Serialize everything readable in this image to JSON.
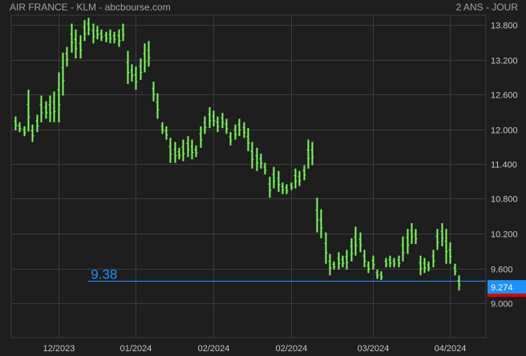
{
  "header": {
    "title": "AIR FRANCE - KLM - abcbourse.com",
    "period": "2 ANS - JOUR"
  },
  "colors": {
    "background": "#1e1e1e",
    "grid": "#3c3c3c",
    "bars": "#7cfc5c",
    "reference_line": "#1e90ff",
    "last_price_badge": "#1e90ff",
    "badge_underline": "#e00000",
    "text": "#a8a8a8"
  },
  "chart_data": {
    "type": "ohlc",
    "title": "AIR FRANCE - KLM - abcbourse.com",
    "ylim": [
      8.9,
      13.95
    ],
    "y_ticks": [
      "13.800",
      "13.200",
      "12.600",
      "12.000",
      "11.400",
      "10.800",
      "10.200",
      "9.600",
      "9.000"
    ],
    "y_tick_values": [
      13.8,
      13.2,
      12.6,
      12.0,
      11.4,
      10.8,
      10.2,
      9.6,
      9.0
    ],
    "x_ticks": [
      "12/2023",
      "01/2024",
      "02/2024",
      "02/2024",
      "03/2024",
      "04/2024"
    ],
    "x_tick_positions": [
      10,
      28,
      46,
      64,
      83,
      101
    ],
    "reference_line": {
      "value": 9.38,
      "label": "9.38",
      "start_index": 17
    },
    "last_price": {
      "value": 9.274,
      "label": "9.274"
    },
    "grid": true,
    "bars": [
      {
        "h": 12.22,
        "l": 11.98
      },
      {
        "h": 12.12,
        "l": 11.95
      },
      {
        "h": 12.05,
        "l": 11.88
      },
      {
        "h": 12.68,
        "l": 11.96
      },
      {
        "h": 12.08,
        "l": 11.78
      },
      {
        "h": 12.25,
        "l": 11.95
      },
      {
        "h": 12.58,
        "l": 12.12
      },
      {
        "h": 12.48,
        "l": 12.18
      },
      {
        "h": 12.58,
        "l": 12.12
      },
      {
        "h": 12.65,
        "l": 12.12
      },
      {
        "h": 12.98,
        "l": 12.12
      },
      {
        "h": 13.32,
        "l": 12.58
      },
      {
        "h": 13.42,
        "l": 13.08
      },
      {
        "h": 13.82,
        "l": 13.32
      },
      {
        "h": 13.72,
        "l": 13.22
      },
      {
        "h": 13.62,
        "l": 13.22
      },
      {
        "h": 13.88,
        "l": 13.52
      },
      {
        "h": 13.92,
        "l": 13.62
      },
      {
        "h": 13.82,
        "l": 13.48
      },
      {
        "h": 13.78,
        "l": 13.55
      },
      {
        "h": 13.72,
        "l": 13.52
      },
      {
        "h": 13.68,
        "l": 13.5
      },
      {
        "h": 13.72,
        "l": 13.48
      },
      {
        "h": 13.68,
        "l": 13.48
      },
      {
        "h": 13.72,
        "l": 13.42
      },
      {
        "h": 13.82,
        "l": 13.52
      },
      {
        "h": 13.35,
        "l": 12.78
      },
      {
        "h": 13.12,
        "l": 12.82
      },
      {
        "h": 13.08,
        "l": 12.68
      },
      {
        "h": 13.22,
        "l": 12.85
      },
      {
        "h": 13.48,
        "l": 12.98
      },
      {
        "h": 13.52,
        "l": 13.08
      },
      {
        "h": 12.82,
        "l": 12.48
      },
      {
        "h": 12.62,
        "l": 12.18
      },
      {
        "h": 12.12,
        "l": 11.92
      },
      {
        "h": 12.05,
        "l": 11.82
      },
      {
        "h": 11.85,
        "l": 11.42
      },
      {
        "h": 11.78,
        "l": 11.42
      },
      {
        "h": 11.68,
        "l": 11.48
      },
      {
        "h": 11.82,
        "l": 11.45
      },
      {
        "h": 11.88,
        "l": 11.52
      },
      {
        "h": 11.82,
        "l": 11.48
      },
      {
        "h": 11.72,
        "l": 11.52
      },
      {
        "h": 12.05,
        "l": 11.68
      },
      {
        "h": 12.22,
        "l": 11.92
      },
      {
        "h": 12.38,
        "l": 12.02
      },
      {
        "h": 12.32,
        "l": 12.05
      },
      {
        "h": 12.22,
        "l": 11.95
      },
      {
        "h": 12.28,
        "l": 12.02
      },
      {
        "h": 12.18,
        "l": 11.92
      },
      {
        "h": 11.95,
        "l": 11.72
      },
      {
        "h": 12.08,
        "l": 11.82
      },
      {
        "h": 12.18,
        "l": 11.88
      },
      {
        "h": 12.12,
        "l": 11.85
      },
      {
        "h": 12.02,
        "l": 11.62
      },
      {
        "h": 11.78,
        "l": 11.32
      },
      {
        "h": 11.68,
        "l": 11.28
      },
      {
        "h": 11.58,
        "l": 11.32
      },
      {
        "h": 11.42,
        "l": 11.22
      },
      {
        "h": 11.18,
        "l": 10.82
      },
      {
        "h": 11.35,
        "l": 10.98
      },
      {
        "h": 11.28,
        "l": 10.92
      },
      {
        "h": 11.08,
        "l": 10.88
      },
      {
        "h": 11.05,
        "l": 10.88
      },
      {
        "h": 11.08,
        "l": 10.95
      },
      {
        "h": 11.32,
        "l": 10.98
      },
      {
        "h": 11.28,
        "l": 11.02
      },
      {
        "h": 11.38,
        "l": 11.12
      },
      {
        "h": 11.82,
        "l": 11.32
      },
      {
        "h": 11.78,
        "l": 11.38
      },
      {
        "h": 10.82,
        "l": 10.22
      },
      {
        "h": 10.62,
        "l": 10.12
      },
      {
        "h": 10.22,
        "l": 9.68
      },
      {
        "h": 9.85,
        "l": 9.48
      },
      {
        "h": 9.72,
        "l": 9.58
      },
      {
        "h": 9.88,
        "l": 9.58
      },
      {
        "h": 9.82,
        "l": 9.62
      },
      {
        "h": 9.92,
        "l": 9.58
      },
      {
        "h": 10.12,
        "l": 9.72
      },
      {
        "h": 10.32,
        "l": 9.82
      },
      {
        "h": 10.22,
        "l": 9.88
      },
      {
        "h": 9.92,
        "l": 9.62
      },
      {
        "h": 9.72,
        "l": 9.52
      },
      {
        "h": 9.82,
        "l": 9.58
      },
      {
        "h": 9.58,
        "l": 9.42
      },
      {
        "h": 9.55,
        "l": 9.4
      },
      {
        "h": 9.78,
        "l": 9.62
      },
      {
        "h": 9.82,
        "l": 9.62
      },
      {
        "h": 9.78,
        "l": 9.62
      },
      {
        "h": 9.82,
        "l": 9.62
      },
      {
        "h": 10.15,
        "l": 9.72
      },
      {
        "h": 10.28,
        "l": 9.85
      },
      {
        "h": 10.38,
        "l": 10.02
      },
      {
        "h": 10.28,
        "l": 10.02
      },
      {
        "h": 9.82,
        "l": 9.48
      },
      {
        "h": 9.78,
        "l": 9.52
      },
      {
        "h": 9.72,
        "l": 9.55
      },
      {
        "h": 9.92,
        "l": 9.62
      },
      {
        "h": 10.28,
        "l": 9.92
      },
      {
        "h": 10.38,
        "l": 9.98
      },
      {
        "h": 10.28,
        "l": 9.68
      },
      {
        "h": 10.05,
        "l": 9.68
      },
      {
        "h": 9.68,
        "l": 9.48
      },
      {
        "h": 9.48,
        "l": 9.22
      }
    ]
  }
}
